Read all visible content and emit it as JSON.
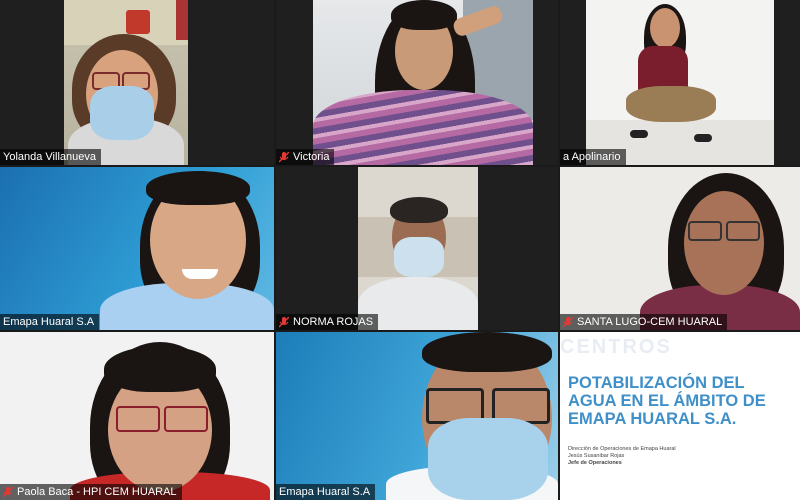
{
  "participants": [
    {
      "name": "Yolanda Villanueva",
      "muted": false
    },
    {
      "name": "Victoria",
      "muted": true
    },
    {
      "name": "a Apolinario",
      "muted": false
    },
    {
      "name": "Emapa Huaral S.A",
      "muted": false
    },
    {
      "name": "NORMA ROJAS",
      "muted": true
    },
    {
      "name": "SANTA LUGO-CEM HUARAL",
      "muted": true
    },
    {
      "name": "Paola Baca - HPI CEM HUARAL",
      "muted": true
    },
    {
      "name": "Emapa Huaral S.A",
      "muted": false
    }
  ],
  "shared_slide": {
    "watermark": "CENTROS",
    "title": "POTABILIZACIÓN DEL AGUA EN EL ÁMBITO DE EMAPA HUARAL S.A.",
    "lines": [
      "Dirección de Operaciones de Emapa Huaral",
      "Jesús Susanibar Rojas",
      "Jefe de Operaciones"
    ]
  },
  "colors": {
    "muted_icon": "#e53935",
    "slide_title": "#3f8fc8"
  },
  "icons": {
    "muted": "mic-muted-icon"
  }
}
